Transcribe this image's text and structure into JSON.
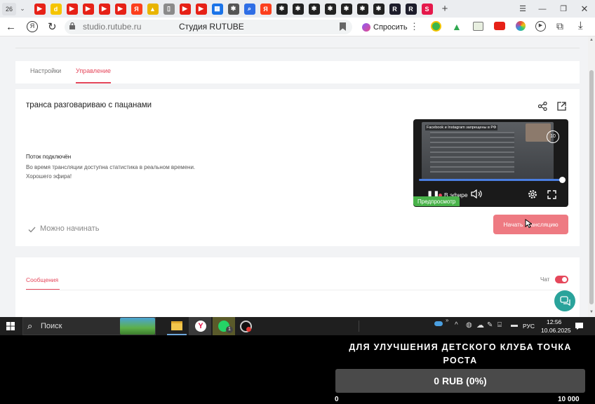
{
  "browser": {
    "tab_count": "26",
    "tab_icons": [
      {
        "name": "youtube-tab-icon",
        "color": "#e62117",
        "glyph": "▶"
      },
      {
        "name": "d-tab-icon",
        "color": "#f5c400",
        "glyph": "d"
      },
      {
        "name": "youtube-tab-icon",
        "color": "#e62117",
        "glyph": "▶"
      },
      {
        "name": "youtube-tab-icon",
        "color": "#e62117",
        "glyph": "▶"
      },
      {
        "name": "youtube-tab-icon",
        "color": "#e62117",
        "glyph": "▶"
      },
      {
        "name": "youtube-tab-icon",
        "color": "#e62117",
        "glyph": "▶"
      },
      {
        "name": "yandex-tab-icon",
        "color": "#fc3f1d",
        "glyph": "Я"
      },
      {
        "name": "image-tab-icon",
        "color": "#e8b400",
        "glyph": "▲"
      },
      {
        "name": "document-tab-icon",
        "color": "#8a8a8a",
        "glyph": "▯"
      },
      {
        "name": "youtube-tab-icon",
        "color": "#e62117",
        "glyph": "▶"
      },
      {
        "name": "youtube-tab-icon",
        "color": "#e62117",
        "glyph": "▶"
      },
      {
        "name": "grid-tab-icon",
        "color": "#1a73e8",
        "glyph": "▦"
      },
      {
        "name": "gear-tab-icon",
        "color": "#555555",
        "glyph": "✱"
      },
      {
        "name": "search-tab-icon",
        "color": "#2f6ee5",
        "glyph": "⌕"
      },
      {
        "name": "yandex-tab-icon",
        "color": "#fc3f1d",
        "glyph": "Я"
      },
      {
        "name": "star-tab-icon",
        "color": "#222222",
        "glyph": "✱"
      },
      {
        "name": "star-tab-icon",
        "color": "#222222",
        "glyph": "✱"
      },
      {
        "name": "star-tab-icon",
        "color": "#222222",
        "glyph": "✱"
      },
      {
        "name": "star-tab-icon",
        "color": "#222222",
        "glyph": "✱"
      },
      {
        "name": "star-tab-icon",
        "color": "#222222",
        "glyph": "✱"
      },
      {
        "name": "star-tab-icon",
        "color": "#222222",
        "glyph": "✱"
      },
      {
        "name": "star-tab-icon",
        "color": "#222222",
        "glyph": "✱"
      },
      {
        "name": "rutube-tab-icon",
        "color": "#1d1d2b",
        "glyph": "R"
      },
      {
        "name": "rutube-tab-icon",
        "color": "#1d1d2b",
        "glyph": "R"
      },
      {
        "name": "rutube-studio-tab-icon",
        "color": "#e5194b",
        "glyph": "S"
      }
    ],
    "url": "studio.rutube.ru",
    "page_title": "Студия RUTUBE",
    "ask_label": "Спросить"
  },
  "page": {
    "tabs": [
      {
        "label": "Настройки",
        "active": false
      },
      {
        "label": "Управление",
        "active": true
      }
    ],
    "stream_title": "транса разговариваю с пацанами",
    "status_heading": "Поток подключён",
    "status_line1": "Во время трансляции доступна статистика в реальном времени.",
    "status_line2": "Хорошего эфира!",
    "ready_label": "Можно начинать",
    "start_button": "Начать трансляцию",
    "preview_badge": "Предпросмотр",
    "video_caption": "Facebook и Instagram запрещены в РФ",
    "live_label": "В эфире",
    "messages_tab": "Сообщения",
    "chat_label": "Чат",
    "chat_enabled": true,
    "accent": "#e5475b"
  },
  "taskbar": {
    "search_label": "Поиск",
    "lang": "РУС",
    "time": "12:56",
    "date": "10.06.2025",
    "whatsapp_badge": "1"
  },
  "donation": {
    "title": "ДЛЯ УЛУЧШЕНИЯ ДЕТСКОГО КЛУБА ТОЧКА РОСТА",
    "amount": "0 RUB (0%)",
    "progress": 0,
    "min_label": "0",
    "max_label": "10 000"
  }
}
